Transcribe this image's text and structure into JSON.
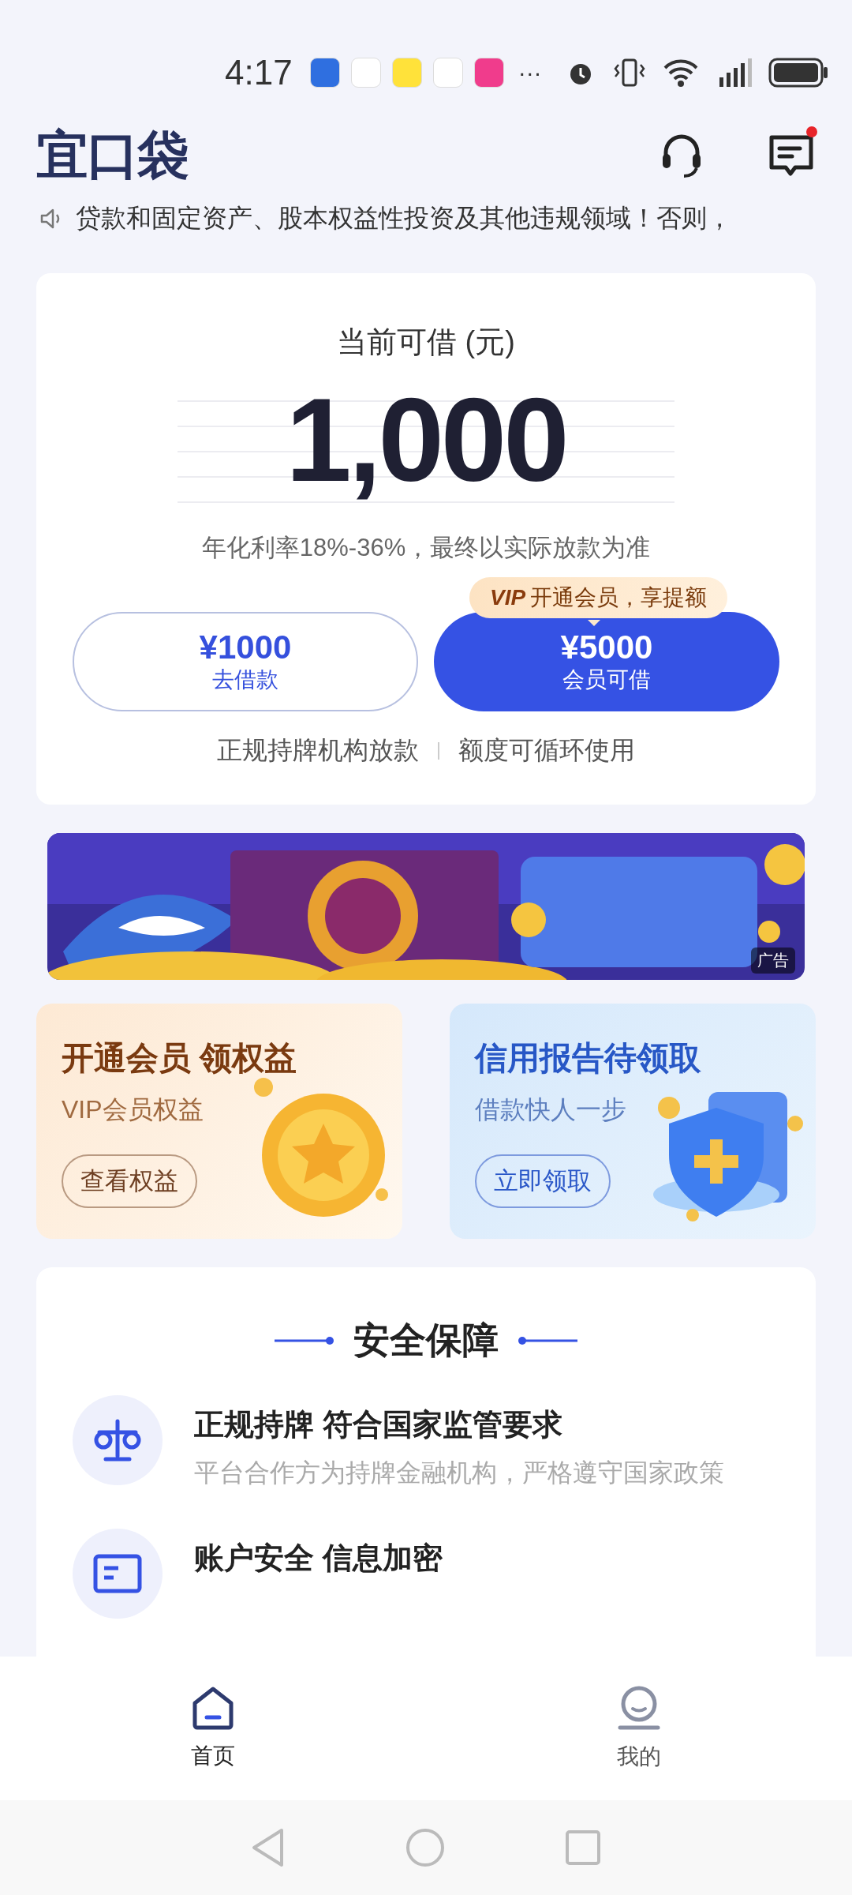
{
  "status_bar": {
    "time": "4:17",
    "more": "···"
  },
  "header": {
    "logo": "宜口袋",
    "unread_messages": true
  },
  "notice": {
    "text": "贷款和固定资产、股本权益性投资及其他违规领域！否则，"
  },
  "credit_card": {
    "label": "当前可借 (元)",
    "amount": "1,000",
    "rate_note": "年化利率18%-36%，最终以实际放款为准",
    "buttons": [
      {
        "kind": "outline",
        "amount": "¥1000",
        "label": "去借款"
      },
      {
        "kind": "filled",
        "amount": "¥5000",
        "label": "会员可借",
        "tag_mark": "VIP",
        "tag": "开通会员，享提额"
      }
    ],
    "features": [
      "正规持牌机构放款",
      "额度可循环使用"
    ]
  },
  "ad_banner": {
    "kind": "picture",
    "badge": "广告"
  },
  "promos": [
    {
      "kind": "vip",
      "title": "开通会员 领权益",
      "subtitle": "VIP会员权益",
      "button": "查看权益"
    },
    {
      "kind": "credit",
      "title": "信用报告待领取",
      "subtitle": "借款快人一步",
      "button": "立即领取"
    }
  ],
  "security": {
    "title": "安全保障",
    "items": [
      {
        "kind": "license",
        "title": "正规持牌 符合国家监管要求",
        "subtitle": "平台合作方为持牌金融机构，严格遵守国家政策"
      },
      {
        "kind": "account",
        "title": "账户安全 信息加密"
      }
    ]
  },
  "bottom_nav": [
    {
      "kind": "home",
      "label": "首页",
      "selected": true
    },
    {
      "kind": "profile",
      "label": "我的",
      "selected": false
    }
  ]
}
